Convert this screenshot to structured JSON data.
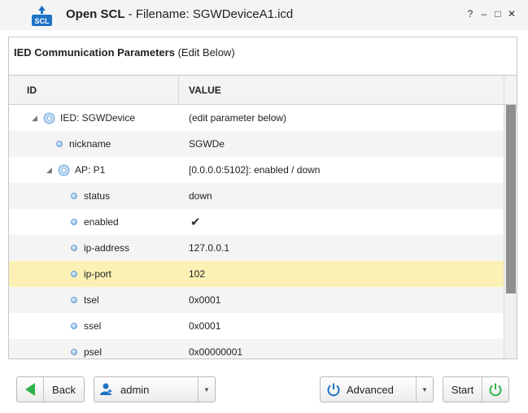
{
  "window": {
    "app_name": "Open SCL",
    "separator": " - ",
    "filename_label": "Filename: SGWDeviceA1.icd",
    "help_label": "?",
    "minimize_label": "–",
    "maximize_label": "□",
    "close_label": "✕"
  },
  "panel": {
    "title_bold": "IED Communication Parameters",
    "title_rest": " (Edit Below)"
  },
  "grid": {
    "columns": {
      "id": "ID",
      "value": "VALUE"
    },
    "rows": [
      {
        "id": "IED: SGWDevice",
        "value": "(edit parameter below)",
        "icon": "gear-icon",
        "expander": "◢"
      },
      {
        "id": "nickname",
        "value": "SGWDe",
        "icon": "leaf-icon"
      },
      {
        "id": "AP: P1",
        "value": "[0.0.0.0:5102]: enabled / down",
        "icon": "gear-icon",
        "expander": "◢"
      },
      {
        "id": "status",
        "value": "down",
        "icon": "leaf-icon"
      },
      {
        "id": "enabled",
        "value": "✔",
        "icon": "leaf-icon",
        "checked": true
      },
      {
        "id": "ip-address",
        "value": "127.0.0.1",
        "icon": "leaf-icon"
      },
      {
        "id": "ip-port",
        "value": "102",
        "icon": "leaf-icon",
        "selected": true
      },
      {
        "id": "tsel",
        "value": "0x0001",
        "icon": "leaf-icon"
      },
      {
        "id": "ssel",
        "value": "0x0001",
        "icon": "leaf-icon"
      },
      {
        "id": "psel",
        "value": "0x00000001",
        "icon": "leaf-icon"
      }
    ]
  },
  "buttons": {
    "back": "Back",
    "user": "admin",
    "advanced": "Advanced",
    "start": "Start"
  },
  "colors": {
    "accent_green": "#2db34a",
    "accent_blue": "#1d73c4",
    "selected_row": "#fbf1b4",
    "scroll_thumb": "#8f8f8f"
  },
  "scroll": {
    "visible_fraction": 0.74
  }
}
